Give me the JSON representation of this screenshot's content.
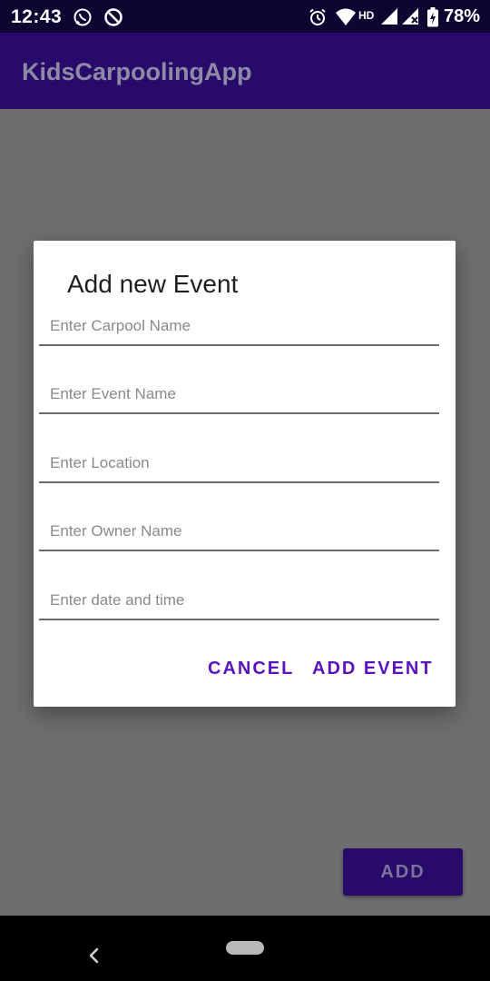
{
  "status_bar": {
    "time": "12:43",
    "network_label": "HD",
    "battery_percent": "78%",
    "icons": [
      "whatsapp-icon",
      "blocked-icon",
      "alarm-icon",
      "wifi-icon",
      "signal-icon",
      "signal-x-icon",
      "battery-charging-icon"
    ]
  },
  "app_bar": {
    "title": "KidsCarpoolingApp"
  },
  "dialog": {
    "title": "Add new Event",
    "fields": [
      {
        "placeholder": "Enter Carpool Name",
        "value": ""
      },
      {
        "placeholder": "Enter Event Name",
        "value": ""
      },
      {
        "placeholder": "Enter Location",
        "value": ""
      },
      {
        "placeholder": "Enter Owner Name",
        "value": ""
      },
      {
        "placeholder": "Enter date and time",
        "value": ""
      }
    ],
    "cancel_label": "CANCEL",
    "confirm_label": "ADD EVENT"
  },
  "main": {
    "add_button_label": "ADD"
  },
  "nav_bar": {
    "icons": [
      "back-icon",
      "home-pill"
    ]
  },
  "colors": {
    "accent": "#5b13c0",
    "app_bar": "#280a6a",
    "status_bar": "#0f0532",
    "scrim": "#6e6e6e"
  }
}
